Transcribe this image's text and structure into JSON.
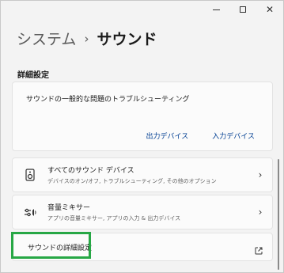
{
  "window": {
    "controls": {
      "minimize": "—",
      "maximize": "□",
      "close": "✕"
    }
  },
  "breadcrumb": {
    "parent": "システム",
    "separator": "›",
    "current": "サウンド"
  },
  "section": {
    "label": "詳細設定"
  },
  "troubleshoot": {
    "title": "サウンドの一般的な問題のトラブルシューティング",
    "output_link": "出力デバイス",
    "input_link": "入力デバイス"
  },
  "rows": {
    "devices": {
      "title": "すべてのサウンド デバイス",
      "subtitle": "デバイスのオン/オフ, トラブルシューティング, その他のオプション",
      "icon": "speaker-icon"
    },
    "mixer": {
      "title": "音量ミキサー",
      "subtitle": "アプリの音量ミキサー, アプリの入力 & 出力デバイス",
      "icon": "volume-mixer-icon"
    },
    "advanced": {
      "title": "サウンドの詳細設定",
      "icon": "external-link-icon"
    }
  },
  "colors": {
    "accent_link": "#003e92",
    "highlight": "#27a745",
    "background": "#f3f3f3"
  }
}
